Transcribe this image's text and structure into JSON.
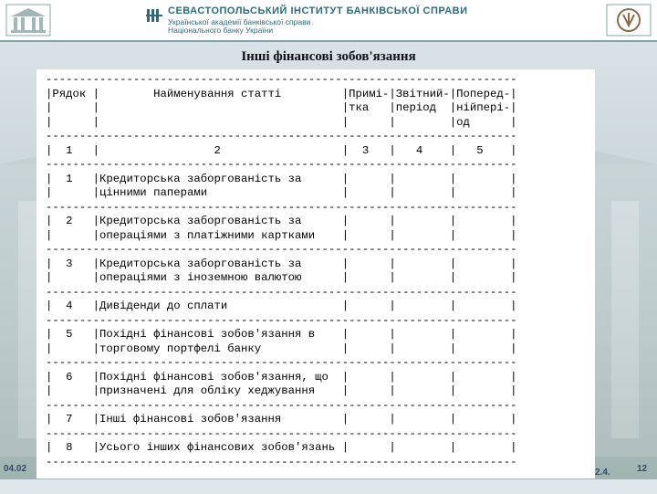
{
  "header": {
    "institute": "СЕВАСТОПОЛЬСЬКИЙ ІНСТИТУТ БАНКІВСЬКОЇ СПРАВИ",
    "subtitle_1": "Української академії банківської справи",
    "subtitle_2": "Національного банку України"
  },
  "slide": {
    "title": "Інші фінансові зобов'язання"
  },
  "table": {
    "headers": [
      "Рядок",
      "Найменування статті",
      "Примітка",
      "Звітний період",
      "Попередній період"
    ],
    "column_numbers": [
      "1",
      "2",
      "3",
      "4",
      "5"
    ],
    "rows": [
      {
        "num": "1",
        "name": "Кредиторська заборгованість за цінними паперами"
      },
      {
        "num": "2",
        "name": "Кредиторська заборгованість за операціями з платіжними картками"
      },
      {
        "num": "3",
        "name": "Кредиторська заборгованість за операціями з іноземною валютою"
      },
      {
        "num": "4",
        "name": "Дивіденди до сплати"
      },
      {
        "num": "5",
        "name": "Похідні фінансові зобов'язання в торговому портфелі банку"
      },
      {
        "num": "6",
        "name": "Похідні фінансові зобов'язання, що призначені для обліку хеджування"
      },
      {
        "num": "7",
        "name": "Інші фінансові зобов'язання"
      },
      {
        "num": "8",
        "name": "Усього інших фінансових зобов'язань"
      }
    ]
  },
  "footer": {
    "date": "04.02",
    "mid": "2.4.",
    "page": "12"
  }
}
